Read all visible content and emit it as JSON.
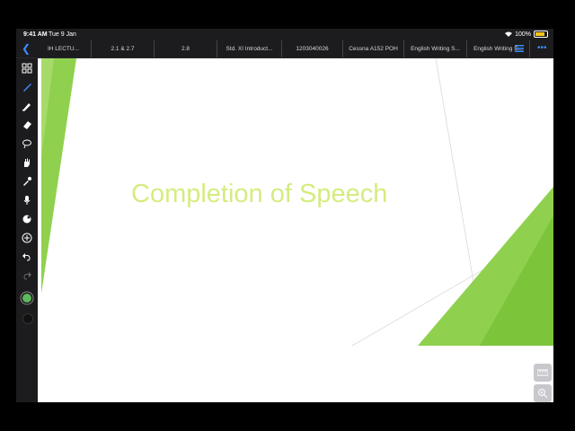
{
  "status_bar": {
    "time": "9:41 AM",
    "date": "Tue 9 Jan",
    "battery": "100%"
  },
  "tabs": [
    {
      "label": "IH LECTU...",
      "w": 62
    },
    {
      "label": "2.1 & 2.7",
      "w": 70
    },
    {
      "label": "2.8",
      "w": 70
    },
    {
      "label": "Std. XI Introduct...",
      "w": 72
    },
    {
      "label": "1203040026",
      "w": 68
    },
    {
      "label": "Cessna A152 POH",
      "w": 68
    },
    {
      "label": "English Writing S...",
      "w": 70
    },
    {
      "label": "English Writing S...",
      "w": 70
    }
  ],
  "toolbar_icons": [
    "grid-icon",
    "pen-icon",
    "highlighter-icon",
    "eraser-icon",
    "lasso-icon",
    "hand-icon",
    "eyedropper-icon",
    "microphone-icon",
    "shapes-icon",
    "add-icon",
    "undo-icon",
    "redo-icon"
  ],
  "colors": {
    "accent": "#3a8bff",
    "pen_color": "#5cb85c",
    "ink_black": "#111111",
    "slide_green": "#8bc34a",
    "title_green": "#d4ec80"
  },
  "slide": {
    "title": "Completion of Speech"
  },
  "side_controls": [
    "ruler-icon",
    "zoom-icon"
  ]
}
